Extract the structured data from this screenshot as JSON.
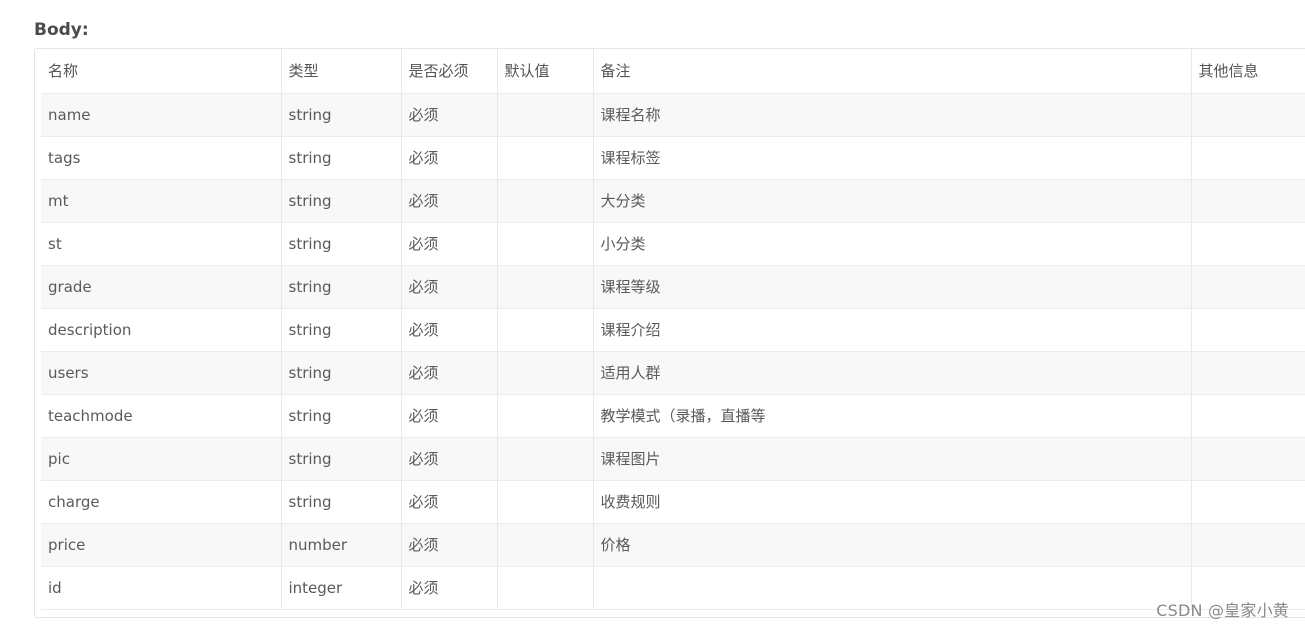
{
  "section": {
    "title": "Body:"
  },
  "table": {
    "headers": [
      "名称",
      "类型",
      "是否必须",
      "默认值",
      "备注",
      "其他信息"
    ],
    "rows": [
      [
        "name",
        "string",
        "必须",
        "",
        "课程名称",
        ""
      ],
      [
        "tags",
        "string",
        "必须",
        "",
        "课程标签",
        ""
      ],
      [
        "mt",
        "string",
        "必须",
        "",
        "大分类",
        ""
      ],
      [
        "st",
        "string",
        "必须",
        "",
        "小分类",
        ""
      ],
      [
        "grade",
        "string",
        "必须",
        "",
        "课程等级",
        ""
      ],
      [
        "description",
        "string",
        "必须",
        "",
        "课程介绍",
        ""
      ],
      [
        "users",
        "string",
        "必须",
        "",
        "适用人群",
        ""
      ],
      [
        "teachmode",
        "string",
        "必须",
        "",
        "教学模式（录播，直播等",
        ""
      ],
      [
        "pic",
        "string",
        "必须",
        "",
        "课程图片",
        ""
      ],
      [
        "charge",
        "string",
        "必须",
        "",
        "收费规则",
        ""
      ],
      [
        "price",
        "number",
        "必须",
        "",
        "价格",
        ""
      ],
      [
        "id",
        "integer",
        "必须",
        "",
        "",
        ""
      ]
    ]
  },
  "watermark": "CSDN @皇家小黄"
}
